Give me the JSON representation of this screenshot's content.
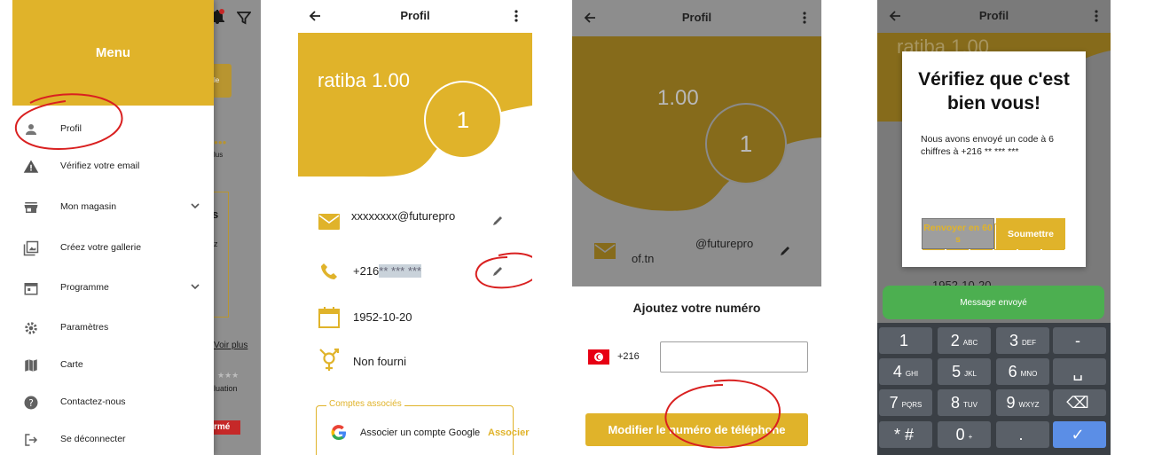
{
  "panel1": {
    "drawer_title": "Menu",
    "menu_items": [
      {
        "label": "Profil",
        "icon": "person-icon"
      },
      {
        "label": "Vérifiez votre email",
        "icon": "warning-icon"
      },
      {
        "label": "Mon magasin",
        "icon": "store-icon"
      },
      {
        "label": "Créez votre gallerie",
        "icon": "gallery-icon"
      },
      {
        "label": "Programme",
        "icon": "calendar-icon"
      },
      {
        "label": "Paramètres",
        "icon": "gear-icon"
      },
      {
        "label": "Carte",
        "icon": "map-icon"
      },
      {
        "label": "Contactez-nous",
        "icon": "help-icon"
      },
      {
        "label": "Se déconnecter",
        "icon": "logout-icon"
      }
    ],
    "background_fragments": {
      "ferme": "rmé",
      "voir_plus": "Voir plus",
      "luation": "luation",
      "plus": "lus",
      "s": "s",
      "z": "z",
      "le": "le"
    }
  },
  "panel2": {
    "title": "Profil",
    "user_name": "ratiba 1.00",
    "avatar_initial": "1",
    "email": "xxxxxxxx@futurepro",
    "phone_prefix": "+216",
    "phone_masked": "** *** ***",
    "birthdate": "1952-10-20",
    "gender": "Non fourni",
    "linked_accounts_legend": "Comptes associés",
    "google_link_text": "Associer un compte Google",
    "google_link_action": "Associer"
  },
  "panel3": {
    "title": "Profil",
    "name_fragment": "1.00",
    "avatar_initial": "1",
    "email_fragment": "@futurepro",
    "email_fragment2": "of.tn",
    "sheet_title": "Ajoutez votre numéro",
    "country_code": "+216",
    "phone_input_value": "",
    "submit_label": "Modifier le numéro de téléphone"
  },
  "panel4": {
    "title": "Profil",
    "bg_name_fragment": "ratiba 1.00",
    "bg_date_fragment": "1952-10-20",
    "dialog_title": "Vérifiez que c'est bien vous!",
    "dialog_message": "Nous avons envoyé un code à 6 chiffres à +216 ** *** ***",
    "otp_chars": [
      "*",
      "*",
      "*",
      "*",
      "*",
      "*"
    ],
    "resend_label": "Renvoyer en 60 s",
    "submit_label": "Soumettre",
    "toast": "Message envoyé",
    "keys": [
      {
        "digit": "1",
        "letters": ""
      },
      {
        "digit": "2",
        "letters": "ABC"
      },
      {
        "digit": "3",
        "letters": "DEF"
      },
      {
        "digit": "-",
        "letters": ""
      },
      {
        "digit": "4",
        "letters": "GHI"
      },
      {
        "digit": "5",
        "letters": "JKL"
      },
      {
        "digit": "6",
        "letters": "MNO"
      },
      {
        "digit": "␣",
        "letters": ""
      },
      {
        "digit": "7",
        "letters": "PQRS"
      },
      {
        "digit": "8",
        "letters": "TUV"
      },
      {
        "digit": "9",
        "letters": "WXYZ"
      },
      {
        "digit": "⌫",
        "letters": ""
      },
      {
        "digit": "* #",
        "letters": ""
      },
      {
        "digit": "0",
        "letters": "+"
      },
      {
        "digit": ".",
        "letters": ""
      },
      {
        "digit": "✓",
        "letters": ""
      }
    ]
  },
  "colors": {
    "accent": "#e0b32a",
    "annotation": "#d92020",
    "toast": "#4caf50",
    "keyboard": "#3a3f45",
    "key": "#5a6068",
    "key_action": "#5b8ee6"
  }
}
